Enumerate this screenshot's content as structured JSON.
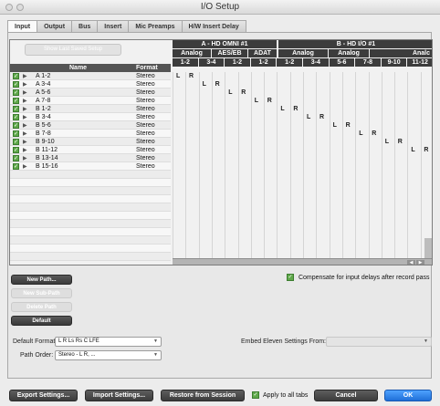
{
  "window": {
    "title": "I/O Setup"
  },
  "tabs": [
    "Input",
    "Output",
    "Bus",
    "Insert",
    "Mic Preamps",
    "H/W Insert Delay"
  ],
  "toolbar": {
    "show_last_saved_label": "Show Last Saved Setup"
  },
  "table": {
    "name_header": "Name",
    "format_header": "Format",
    "rows": [
      {
        "name": "A 1-2",
        "format": "Stereo"
      },
      {
        "name": "A 3-4",
        "format": "Stereo"
      },
      {
        "name": "A 5-6",
        "format": "Stereo"
      },
      {
        "name": "A 7-8",
        "format": "Stereo"
      },
      {
        "name": "B 1-2",
        "format": "Stereo"
      },
      {
        "name": "B 3-4",
        "format": "Stereo"
      },
      {
        "name": "B 5-6",
        "format": "Stereo"
      },
      {
        "name": "B 7-8",
        "format": "Stereo"
      },
      {
        "name": "B 9-10",
        "format": "Stereo"
      },
      {
        "name": "B 11-12",
        "format": "Stereo"
      },
      {
        "name": "B 13-14",
        "format": "Stereo"
      },
      {
        "name": "B 15-16",
        "format": "Stereo"
      }
    ]
  },
  "matrix": {
    "device_a": "A - HD OMNI #1",
    "device_b": "B - HD I/O #1",
    "groups": [
      "Analog",
      "AES/EB",
      "ADAT",
      "Analog",
      "Analog",
      "Analc"
    ],
    "channels": [
      "1-2",
      "3-4",
      "1-2",
      "1-2",
      "1-2",
      "3-4",
      "5-6",
      "7-8",
      "9-10",
      "11-12"
    ],
    "assign_left": "L",
    "assign_right": "R"
  },
  "buttons": {
    "new_path": "New Path...",
    "new_sub_path": "New Sub-Path",
    "delete_path": "Delete Path",
    "default": "Default"
  },
  "compensate": {
    "checked": true,
    "label": "Compensate for input delays after record pass"
  },
  "default_format": {
    "label": "Default Format:",
    "value": "L R Ls Rs C LFE"
  },
  "path_order": {
    "label": "Path Order:",
    "value": "Stereo - L R, ..."
  },
  "embed": {
    "label": "Embed Eleven Settings From:",
    "value": ""
  },
  "footer": {
    "export": "Export Settings...",
    "import": "Import Settings...",
    "restore": "Restore from Session",
    "apply_all": "Apply to all tabs",
    "cancel": "Cancel",
    "ok": "OK"
  },
  "colors": {
    "accent": "#1f6fd8",
    "check": "#5fa84a"
  }
}
